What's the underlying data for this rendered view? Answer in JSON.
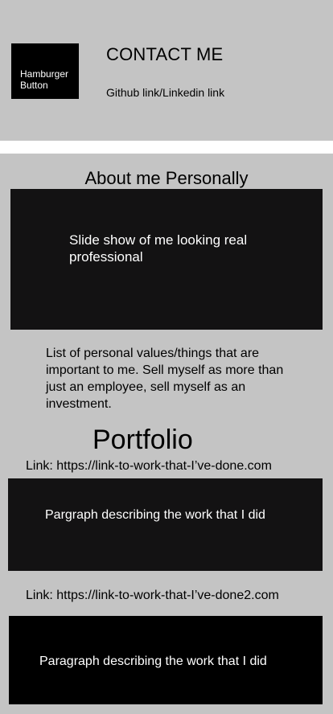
{
  "header": {
    "hamburger_label": "Hamburger\nButton",
    "contact_title": "CONTACT ME",
    "social_link": "Github link/Linkedin link"
  },
  "about": {
    "title": "About me Personally",
    "slideshow_text": "Slide show of me looking real professional",
    "values_text": "List of personal values/things that are important to me. Sell myself as more than just an employee, sell myself as an investment."
  },
  "portfolio": {
    "title": "Portfolio",
    "works": [
      {
        "link": "Link: https://link-to-work-that-I’ve-done.com",
        "description": "Pargraph describing the work that I did"
      },
      {
        "link": "Link: https://link-to-work-that-I’ve-done2.com",
        "description": "Paragraph describing the work that I did"
      }
    ]
  },
  "colors": {
    "background": "#c4c4c4",
    "divider": "#ffffff",
    "dark_panel": "#131213",
    "black_panel": "#000000",
    "text_on_dark": "#ffffff"
  }
}
